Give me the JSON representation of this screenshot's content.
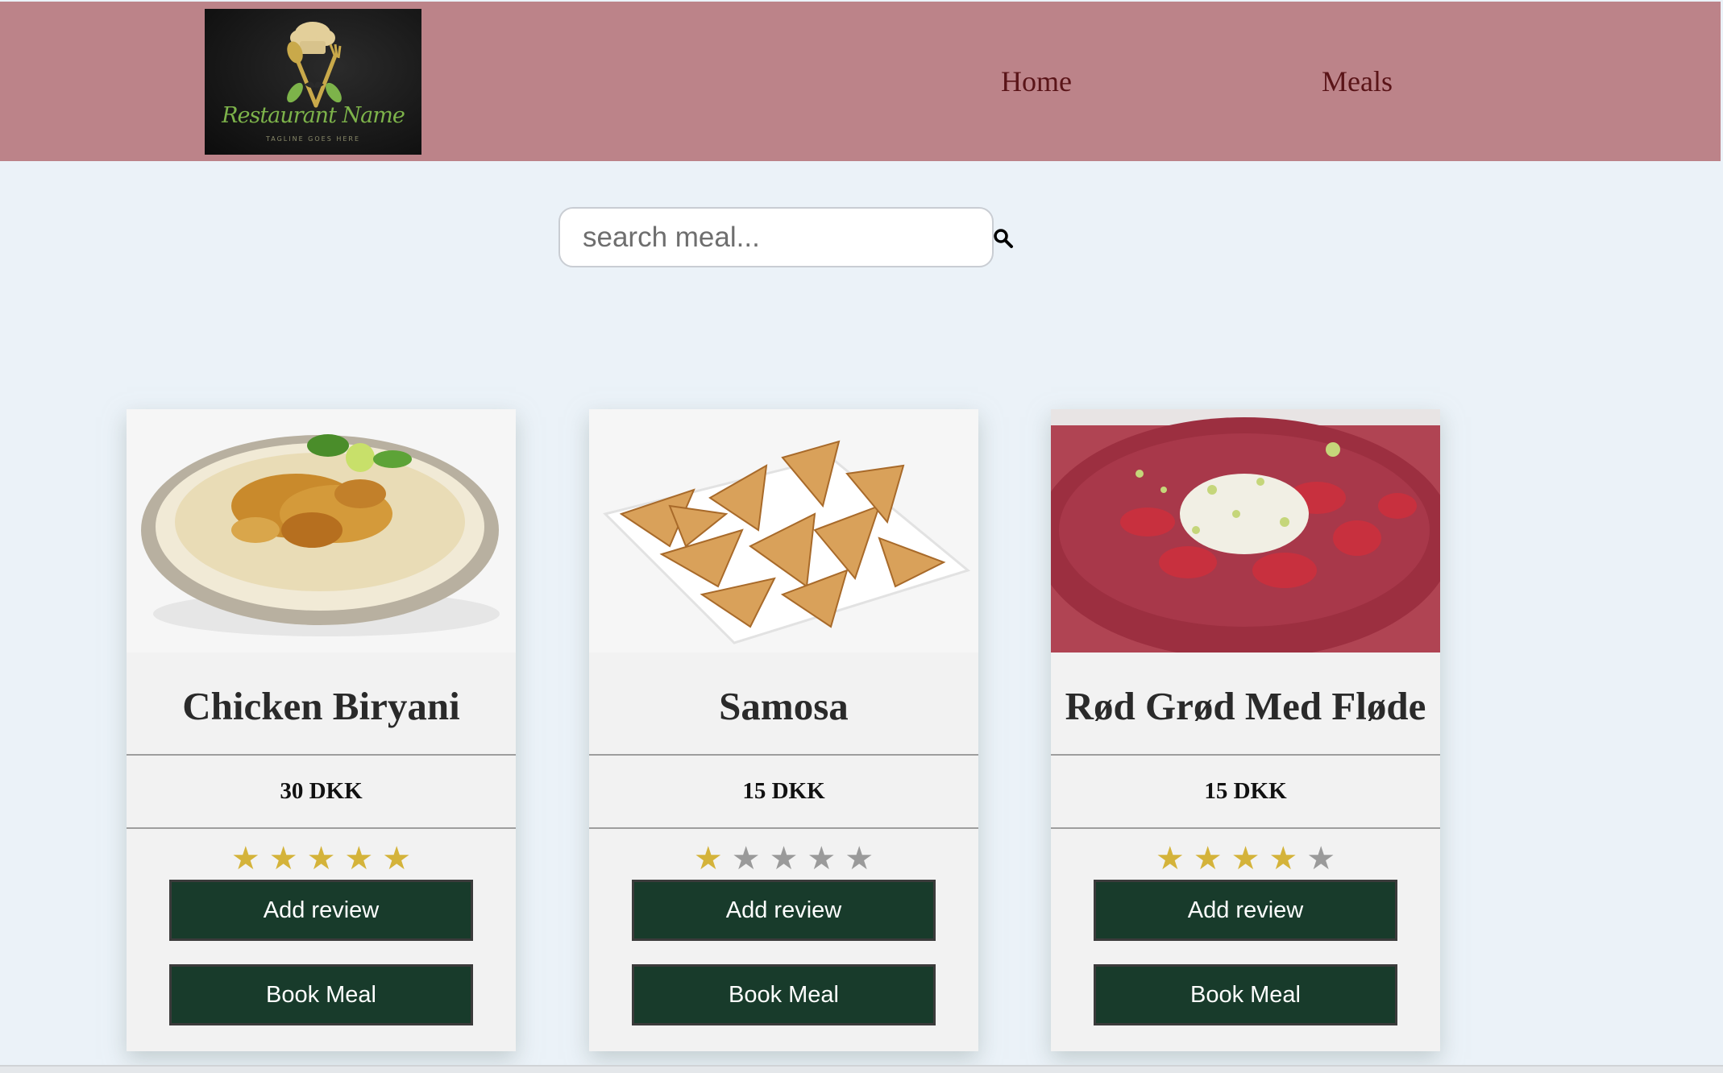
{
  "header": {
    "logo": {
      "name": "Restaurant Name",
      "tagline": "TAGLINE GOES HERE"
    },
    "nav": [
      {
        "label": "Home"
      },
      {
        "label": "Meals"
      }
    ],
    "background_color": "#bc8389"
  },
  "search": {
    "placeholder": "search meal...",
    "value": "",
    "icon": "search-icon"
  },
  "meals": [
    {
      "title": "Chicken Biryani",
      "price": "30 DKK",
      "rating": 5,
      "max_rating": 5,
      "review_label": "Add review",
      "book_label": "Book Meal",
      "image": "chicken-biryani-photo"
    },
    {
      "title": "Samosa",
      "price": "15 DKK",
      "rating": 1,
      "max_rating": 5,
      "review_label": "Add review",
      "book_label": "Book Meal",
      "image": "samosa-photo"
    },
    {
      "title": "Rød Grød Med Fløde",
      "price": "15 DKK",
      "rating": 4,
      "max_rating": 5,
      "review_label": "Add review",
      "book_label": "Book Meal",
      "image": "rod-grod-photo"
    }
  ],
  "colors": {
    "page_background": "#ebf2f8",
    "button_background": "#183b2b",
    "star_filled": "#d4b33a",
    "star_empty": "#9a9a9a",
    "nav_text": "#5a1418"
  }
}
